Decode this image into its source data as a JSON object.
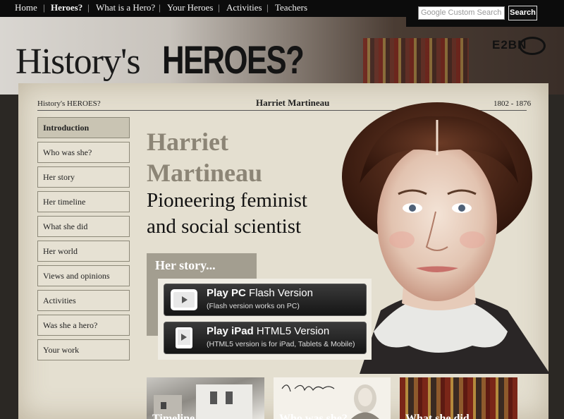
{
  "nav": {
    "items": [
      "Home",
      "Heroes?",
      "What is a Hero?",
      "Your Heroes",
      "Activities",
      "Teachers"
    ],
    "active_index": 1
  },
  "search": {
    "google_label": "Google",
    "placeholder": "Custom Search",
    "button_label": "Search"
  },
  "logo": {
    "part1": "History's",
    "part2": "HEROES?",
    "partner": "E2BN"
  },
  "breadcrumb": {
    "site": "History's HEROES?",
    "title": "Harriet Martineau",
    "dates": "1802 - 1876"
  },
  "sidebar": {
    "items": [
      "Introduction",
      "Who was she?",
      "Her story",
      "Her timeline",
      "What she did",
      "Her world",
      "Views and opinions",
      "Activities",
      "Was she a hero?",
      "Your work"
    ],
    "active_index": 0
  },
  "hero": {
    "name_line1": "Harriet",
    "name_line2": "Martineau",
    "subtitle_line1": "Pioneering feminist",
    "subtitle_line2": "and social scientist"
  },
  "story": {
    "label": "Her story...",
    "pc": {
      "title_bold": "Play PC",
      "title_rest": " Flash Version",
      "note": "(Flash version works on PC)"
    },
    "ipad": {
      "title_bold": "Play iPad",
      "title_rest": " HTML5 Version",
      "note": "(HTML5 version is for iPad, Tablets & Mobile)"
    }
  },
  "thumbnails": [
    {
      "caption": "Timeline"
    },
    {
      "caption": "Who was she?"
    },
    {
      "caption": "What she did"
    }
  ],
  "colors": {
    "nav_bg": "#0c0c0c",
    "paper": "#e4dfd0",
    "name_grey": "#8c8576",
    "button_dark": "#1e1e1e"
  }
}
